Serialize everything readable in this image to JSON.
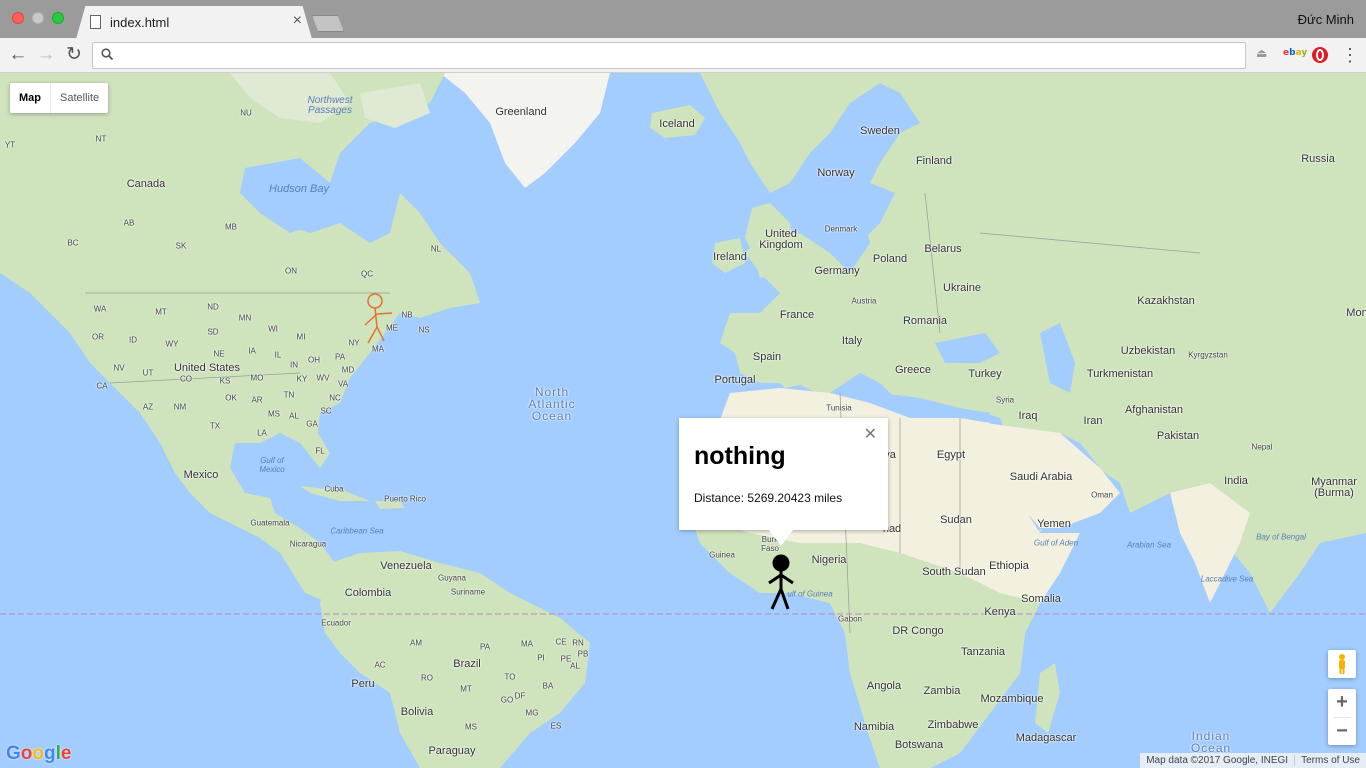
{
  "browser": {
    "tab_title": "index.html",
    "user_name": "Đức Minh",
    "extensions": [
      "ebay"
    ]
  },
  "map": {
    "type_control": {
      "map_label": "Map",
      "satellite_label": "Satellite",
      "selected": "Map"
    },
    "info_window": {
      "title": "nothing",
      "distance": "Distance: 5269.20423 miles"
    },
    "attribution": {
      "data": "Map data ©2017 Google, INEGI",
      "terms": "Terms of Use"
    },
    "logo": "Google",
    "labels": {
      "greenland": "Greenland",
      "iceland": "Iceland",
      "sweden": "Sweden",
      "finland": "Finland",
      "norway": "Norway",
      "russia": "Russia",
      "canada": "Canada",
      "hudson_bay": "Hudson Bay",
      "northwest_passages": "Northwest\nPassages",
      "united_kingdom": "United\nKingdom",
      "ireland": "Ireland",
      "denmark": "Denmark",
      "germany": "Germany",
      "poland": "Poland",
      "belarus": "Belarus",
      "ukraine": "Ukraine",
      "kazakhstan": "Kazakhstan",
      "france": "France",
      "austria": "Austria",
      "romania": "Romania",
      "italy": "Italy",
      "spain": "Spain",
      "portugal": "Portugal",
      "greece": "Greece",
      "turkey": "Turkey",
      "uzbekistan": "Uzbekistan",
      "kyrgyzstan": "Kyrgyzstan",
      "turkmenistan": "Turkmenistan",
      "mongolia": "Mon",
      "syria": "Syria",
      "iraq": "Iraq",
      "iran": "Iran",
      "afghanistan": "Afghanistan",
      "pakistan": "Pakistan",
      "nepal": "Nepal",
      "india": "India",
      "myanmar": "Myanmar\n(Burma)",
      "tunisia": "Tunisia",
      "egypt": "Egypt",
      "saudi_arabia": "Saudi Arabia",
      "oman": "Oman",
      "yemen": "Yemen",
      "gulf_of_aden": "Gulf of Aden",
      "arabian_sea": "Arabian Sea",
      "bay_of_bengal": "Bay of Bengal",
      "laccadive_sea": "Laccadive Sea",
      "sudan": "Sudan",
      "south_sudan": "South Sudan",
      "ethiopia": "Ethiopia",
      "somalia": "Somalia",
      "kenya": "Kenya",
      "nigeria": "Nigeria",
      "chad": "had",
      "guinea": "Guinea",
      "burkina": "Burk\nFaso",
      "gulf_of_guinea": "ulf of Guinea",
      "gabon": "Gabon",
      "dr_congo": "DR Congo",
      "tanzania": "Tanzania",
      "angola": "Angola",
      "zambia": "Zambia",
      "mozambique": "Mozambique",
      "namibia": "Namibia",
      "zimbabwe": "Zimbabwe",
      "botswana": "Botswana",
      "madagascar": "Madagascar",
      "indian_ocean": "Indian\nOcean",
      "libya": "ya",
      "north_atlantic": "North\nAtlantic\nOcean",
      "united_states": "United States",
      "mexico": "Mexico",
      "gulf_of_mexico": "Gulf of\nMexico",
      "cuba": "Cuba",
      "puerto_rico": "Puerto Rico",
      "guatemala": "Guatemala",
      "nicaragua": "Nicaragua",
      "caribbean_sea": "Caribbean Sea",
      "venezuela": "Venezuela",
      "guyana": "Guyana",
      "suriname": "Suriname",
      "colombia": "Colombia",
      "ecuador": "Ecuador",
      "peru": "Peru",
      "brazil": "Brazil",
      "bolivia": "Bolivia",
      "paraguay": "Paraguay",
      "yt": "YT",
      "nt": "NT",
      "nu": "NU",
      "bc": "BC",
      "ab": "AB",
      "sk": "SK",
      "mb": "MB",
      "on": "ON",
      "qc": "QC",
      "nl": "NL",
      "nb": "NB",
      "ns": "NS",
      "wa": "WA",
      "mt": "MT",
      "nd": "ND",
      "mn": "MN",
      "or": "OR",
      "id": "ID",
      "sd": "SD",
      "wy": "WY",
      "wi": "WI",
      "mi": "MI",
      "ne": "NE",
      "ia": "IA",
      "nv": "NV",
      "ut": "UT",
      "co": "CO",
      "ks": "KS",
      "mo": "MO",
      "il": "IL",
      "in": "IN",
      "oh": "OH",
      "pa": "PA",
      "ny": "NY",
      "ca": "CA",
      "az": "AZ",
      "nm": "NM",
      "ok": "OK",
      "ar": "AR",
      "tn": "TN",
      "ky": "KY",
      "wv": "WV",
      "va": "VA",
      "nc": "NC",
      "sc": "SC",
      "tx": "TX",
      "ms": "MS",
      "al": "AL",
      "ga": "GA",
      "la": "LA",
      "fl": "FL",
      "me": "ME",
      "ma": "MA",
      "md": "MD",
      "am": "AM",
      "pa_br": "PA",
      "ma_br": "MA",
      "ce": "CE",
      "rn": "RN",
      "pb": "PB",
      "pi": "PI",
      "pe": "PE",
      "al_br": "AL",
      "ac": "AC",
      "ro": "RO",
      "to": "TO",
      "ba": "BA",
      "mt_br": "MT",
      "go": "GO",
      "df": "DF",
      "mg": "MG",
      "es": "ES",
      "ms_br": "MS"
    }
  }
}
